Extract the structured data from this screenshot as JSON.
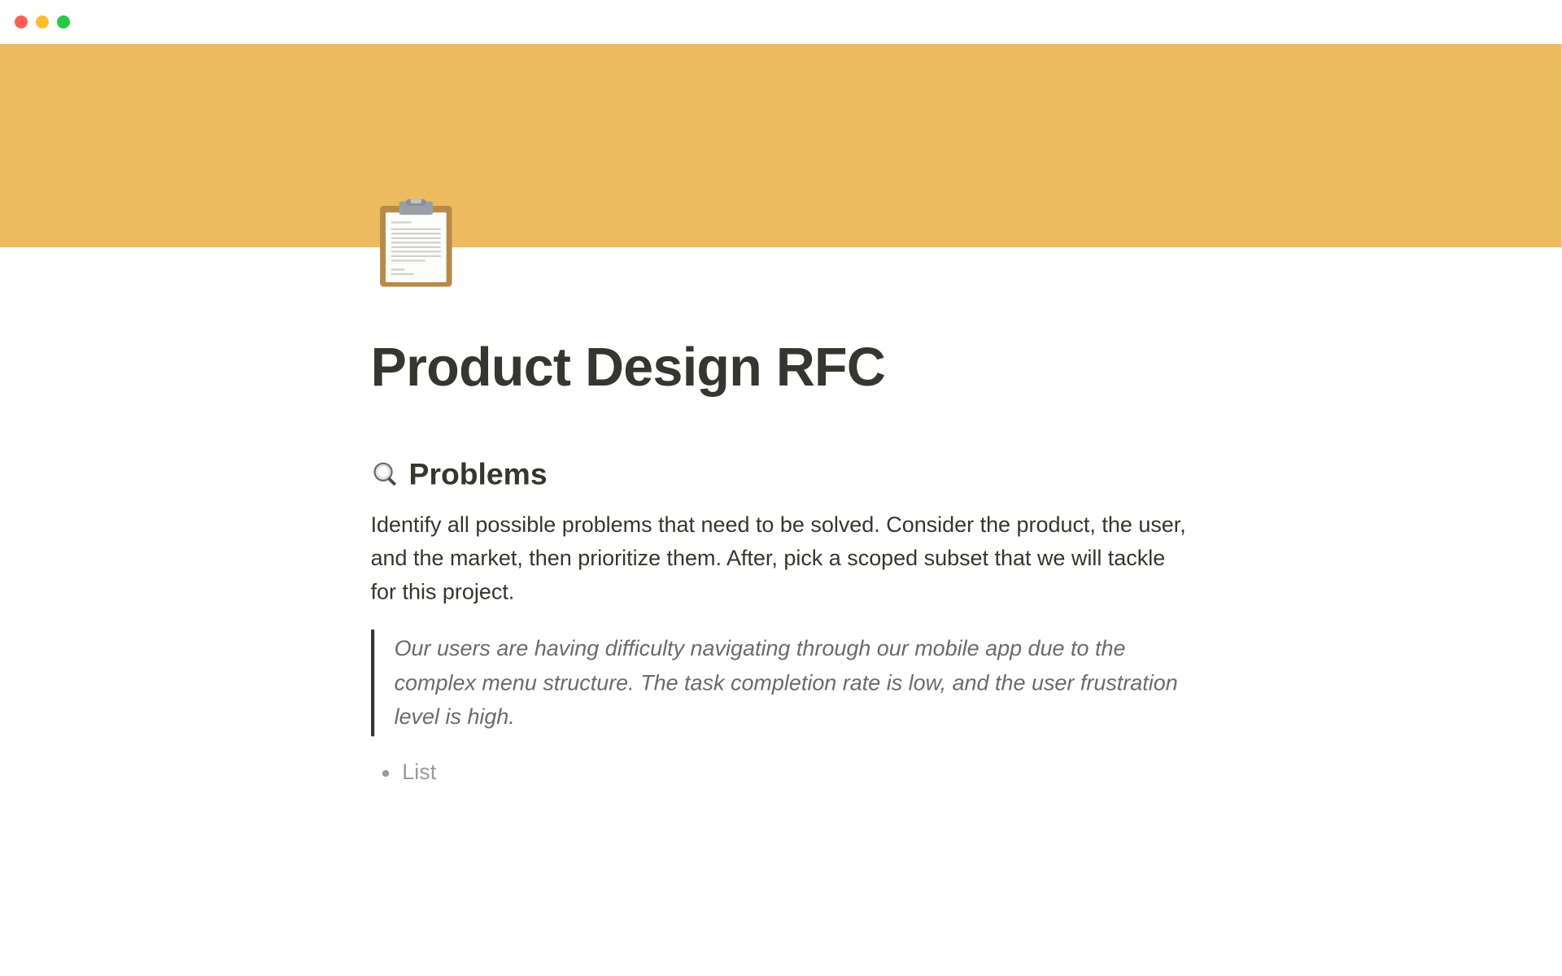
{
  "page": {
    "title": "Product Design RFC",
    "icon_name": "clipboard-icon",
    "cover_color": "#edbb5f"
  },
  "sections": {
    "problems": {
      "icon": "magnifying-glass-icon",
      "heading": "Problems",
      "body": "Identify all possible problems that need to be solved. Consider the product, the user, and the market, then prioritize them. After, pick a scoped subset that we will tackle for this project.",
      "quote": "Our users are having difficulty navigating through our mobile app due to the complex menu structure. The task completion rate is low, and the user frustration level is high.",
      "list_placeholder": "List"
    }
  }
}
